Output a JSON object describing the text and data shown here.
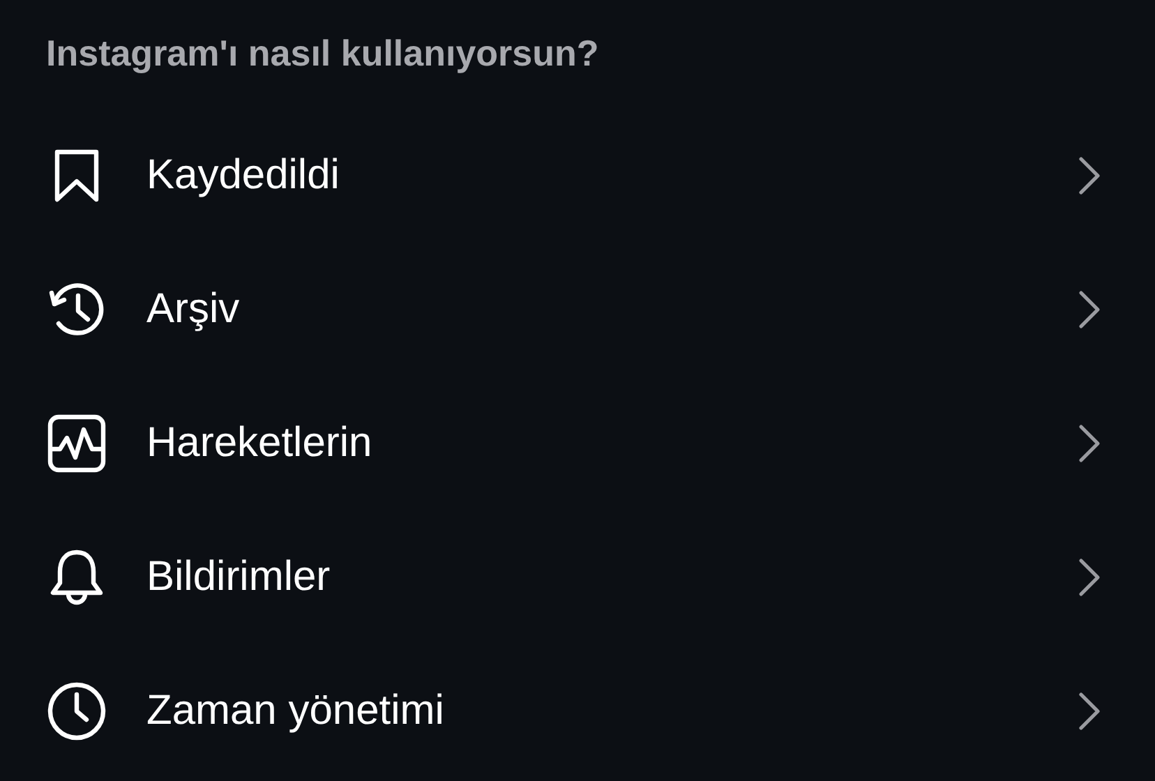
{
  "section_title": "Instagram'ı nasıl kullanıyorsun?",
  "items": [
    {
      "kind": "saved",
      "label": "Kaydedildi"
    },
    {
      "kind": "archive",
      "label": "Arşiv"
    },
    {
      "kind": "activity",
      "label": "Hareketlerin"
    },
    {
      "kind": "notifications",
      "label": "Bildirimler"
    },
    {
      "kind": "time",
      "label": "Zaman yönetimi"
    }
  ]
}
